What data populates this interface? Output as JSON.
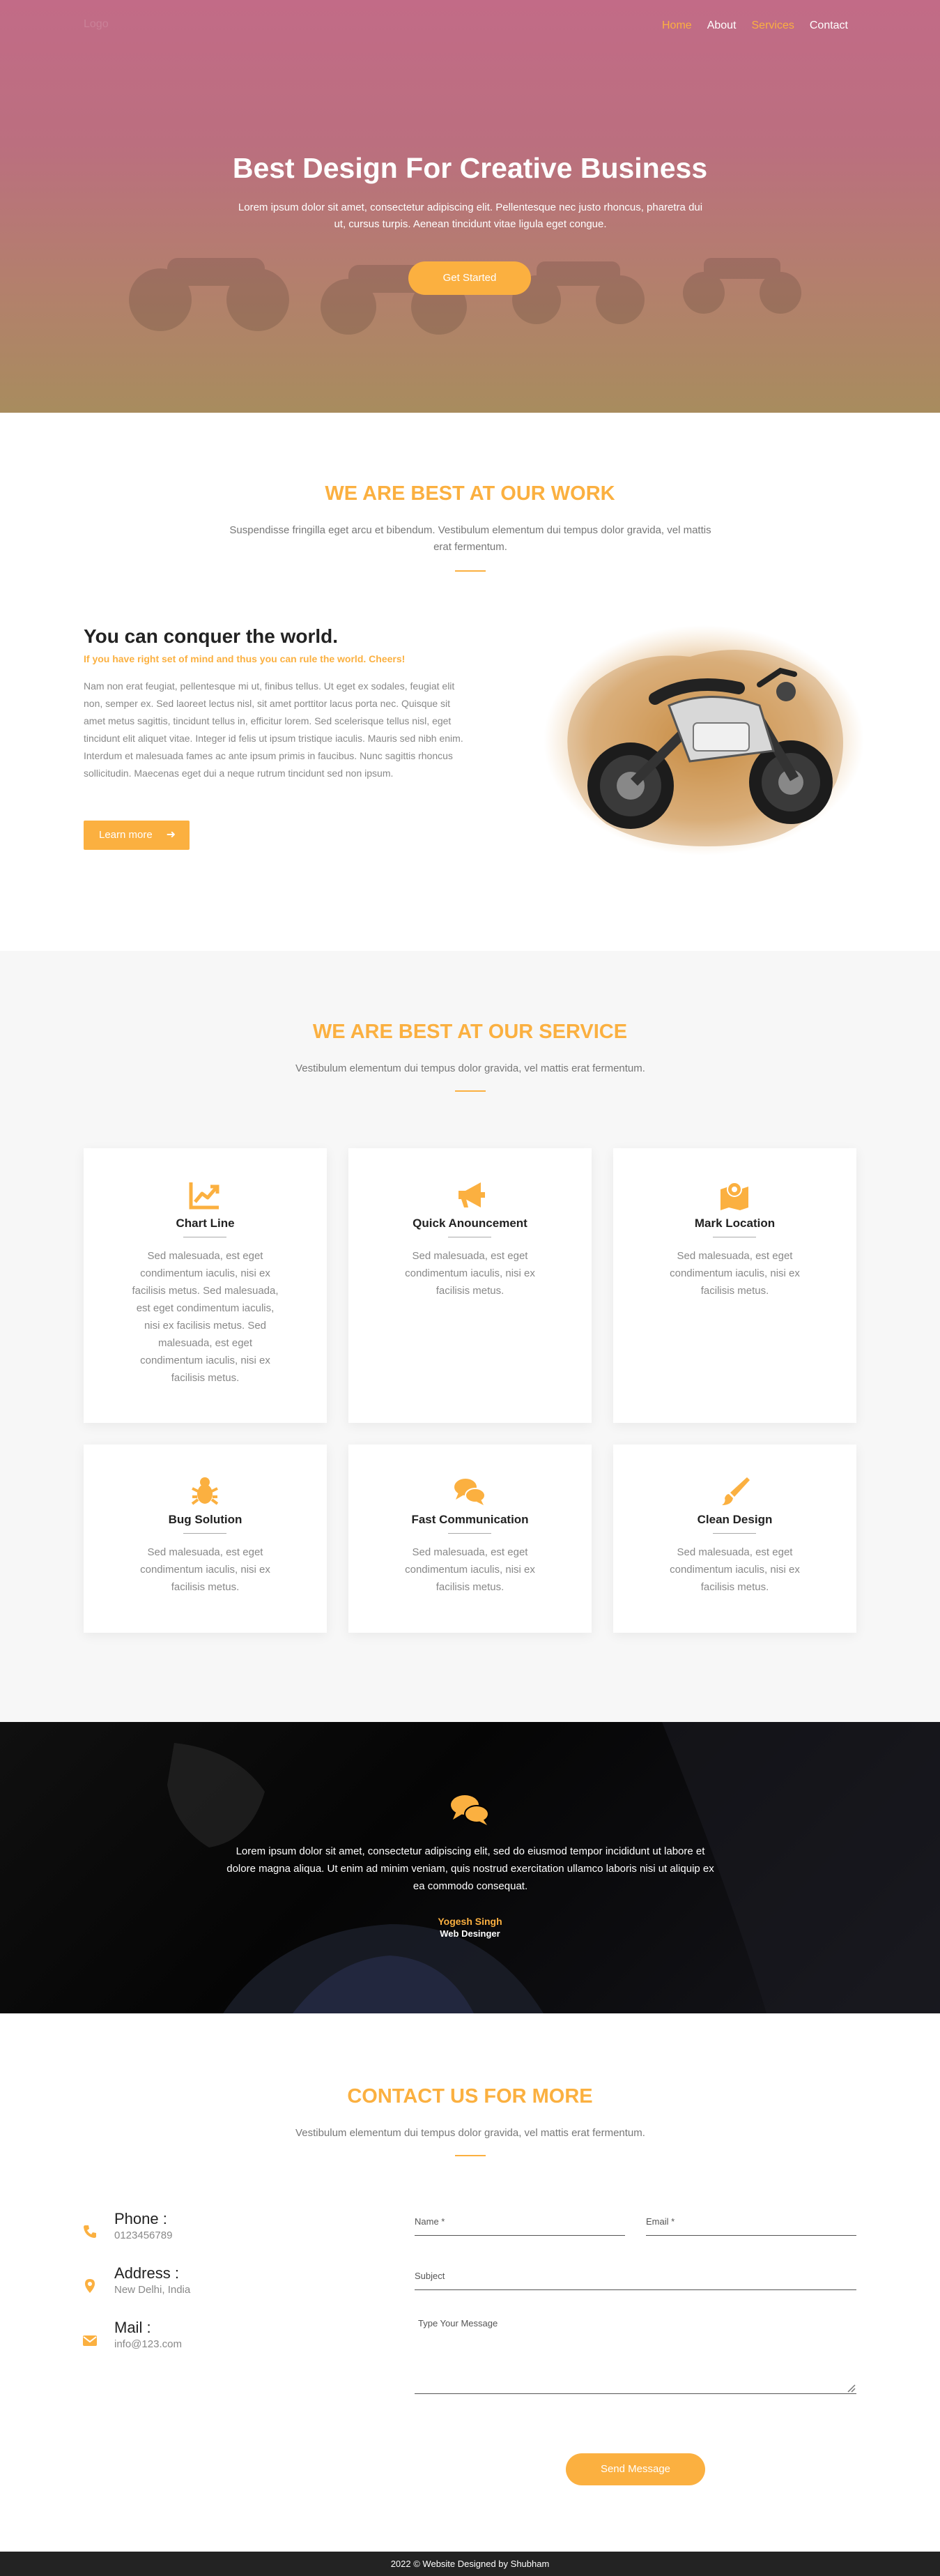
{
  "nav": {
    "logo": "Logo",
    "items": [
      {
        "label": "Home",
        "active": true
      },
      {
        "label": "About",
        "active": false
      },
      {
        "label": "Services",
        "active": true
      },
      {
        "label": "Contact",
        "active": false
      }
    ]
  },
  "hero": {
    "title": "Best Design For Creative Business",
    "text": "Lorem ipsum dolor sit amet, consectetur adipiscing elit. Pellentesque nec justo rhoncus, pharetra dui ut, cursus turpis. Aenean tincidunt vitae ligula eget congue.",
    "button": "Get Started"
  },
  "work": {
    "title": "WE ARE BEST AT OUR WORK",
    "subtitle": "Suspendisse fringilla eget arcu et bibendum. Vestibulum elementum dui tempus dolor gravida, vel mattis erat fermentum.",
    "heading": "You can conquer the world.",
    "tagline": "If you have right set of mind and thus you can rule the world. Cheers!",
    "paragraph": "Nam non erat feugiat, pellentesque mi ut, finibus tellus. Ut eget ex sodales, feugiat elit non, semper ex. Sed laoreet lectus nisl, sit amet porttitor lacus porta nec. Quisque sit amet metus sagittis, tincidunt tellus in, efficitur lorem. Sed scelerisque tellus nisl, eget tincidunt elit aliquet vitae. Integer id felis ut ipsum tristique iaculis. Mauris sed nibh enim. Interdum et malesuada fames ac ante ipsum primis in faucibus. Nunc sagittis rhoncus sollicitudin. Maecenas eget dui a neque rutrum tincidunt sed non ipsum.",
    "button": "Learn more",
    "button_icon": "arrow-right-icon"
  },
  "services": {
    "title": "WE ARE BEST AT OUR SERVICE",
    "subtitle": "Vestibulum elementum dui tempus dolor gravida, vel mattis erat fermentum.",
    "cards": [
      {
        "icon": "chart-line-icon",
        "title": "Chart Line",
        "text": "Sed malesuada, est eget condimentum iaculis, nisi ex facilisis metus. Sed malesuada, est eget condimentum iaculis, nisi ex facilisis metus. Sed malesuada, est eget condimentum iaculis, nisi ex facilisis metus."
      },
      {
        "icon": "bullhorn-icon",
        "title": "Quick Anouncement",
        "text": "Sed malesuada, est eget condimentum iaculis, nisi ex facilisis metus."
      },
      {
        "icon": "map-marker-icon",
        "title": "Mark Location",
        "text": "Sed malesuada, est eget condimentum iaculis, nisi ex facilisis metus."
      },
      {
        "icon": "bug-icon",
        "title": "Bug Solution",
        "text": "Sed malesuada, est eget condimentum iaculis, nisi ex facilisis metus."
      },
      {
        "icon": "comments-icon",
        "title": "Fast Communication",
        "text": "Sed malesuada, est eget condimentum iaculis, nisi ex facilisis metus."
      },
      {
        "icon": "paint-brush-icon",
        "title": "Clean Design",
        "text": "Sed malesuada, est eget condimentum iaculis, nisi ex facilisis metus."
      }
    ]
  },
  "testimonial": {
    "icon": "comments-icon",
    "text": "Lorem ipsum dolor sit amet, consectetur adipiscing elit, sed do eiusmod tempor incididunt ut labore et dolore magna aliqua. Ut enim ad minim veniam, quis nostrud exercitation ullamco laboris nisi ut aliquip ex ea commodo consequat.",
    "name": "Yogesh Singh",
    "role": "Web Desinger"
  },
  "contact": {
    "title": "CONTACT US FOR MORE",
    "subtitle": "Vestibulum elementum dui tempus dolor gravida, vel mattis erat fermentum.",
    "info": [
      {
        "icon": "phone-icon",
        "label": "Phone :",
        "value": "0123456789"
      },
      {
        "icon": "map-marker-icon",
        "label": "Address :",
        "value": "New Delhi, India"
      },
      {
        "icon": "envelope-icon",
        "label": "Mail :",
        "value": "info@123.com"
      }
    ],
    "form": {
      "name_placeholder": "Name *",
      "email_placeholder": "Email *",
      "subject_placeholder": "Subject",
      "message_placeholder": "Type Your Message",
      "send_label": "Send Message"
    }
  },
  "footer": {
    "text": "2022 © Website Designed by Shubham"
  },
  "colors": {
    "accent": "#fbb040",
    "dark": "#232323"
  }
}
